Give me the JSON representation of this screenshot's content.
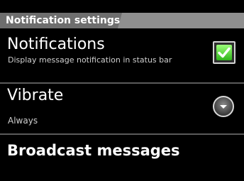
{
  "section": {
    "title": "Notification settings"
  },
  "rows": [
    {
      "title": "Notifications",
      "summary": "Display message notification in status bar",
      "checked": true
    },
    {
      "title": "Vibrate",
      "summary": "Always"
    },
    {
      "title": "Broadcast messages"
    }
  ]
}
